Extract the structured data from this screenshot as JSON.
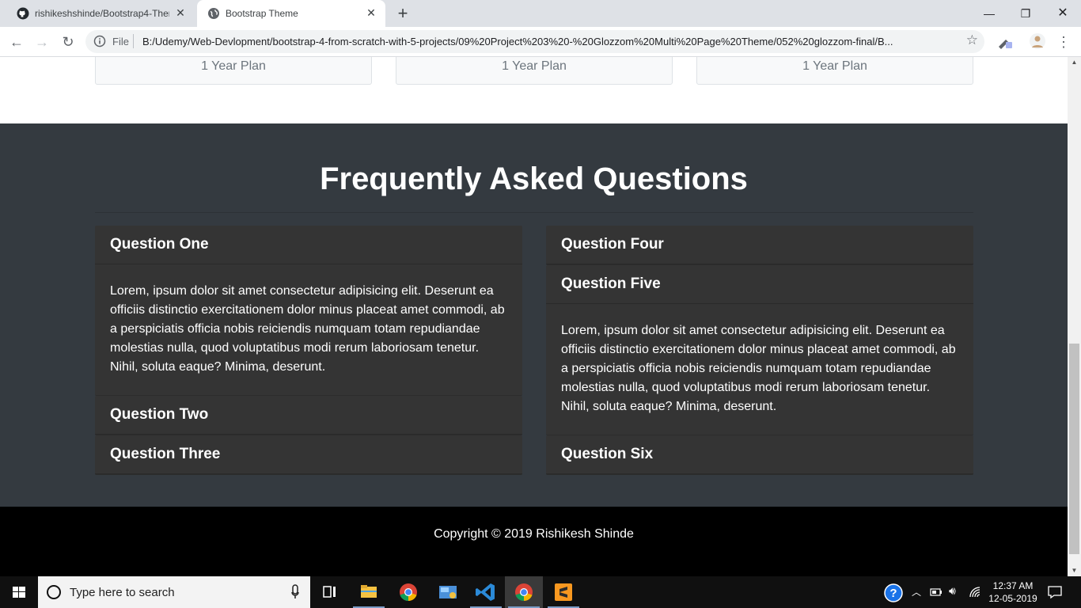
{
  "browser": {
    "tabs": [
      {
        "title": "rishikeshshinde/Bootstrap4-Theme",
        "active": false
      },
      {
        "title": "Bootstrap Theme",
        "active": true
      }
    ],
    "new_tab_label": "+",
    "address_scheme": "File",
    "address_url": "B:/Udemy/Web-Devlopment/bootstrap-4-from-scratch-with-5-projects/09%20Project%203%20-%20Glozzom%20Multi%20Page%20Theme/052%20glozzom-final/B..."
  },
  "page": {
    "plans": [
      {
        "label": "1 Year Plan"
      },
      {
        "label": "1 Year Plan"
      },
      {
        "label": "1 Year Plan"
      }
    ],
    "faq": {
      "title": "Frequently Asked Questions",
      "left": [
        {
          "question": "Question One",
          "answer": "Lorem, ipsum dolor sit amet consectetur adipisicing elit. Deserunt ea officiis distinctio exercitationem dolor minus placeat amet commodi, ab a perspiciatis officia nobis reiciendis numquam totam repudiandae molestias nulla, quod voluptatibus modi rerum laboriosam tenetur. Nihil, soluta eaque? Minima, deserunt.",
          "expanded": true
        },
        {
          "question": "Question Two",
          "answer": "",
          "expanded": false
        },
        {
          "question": "Question Three",
          "answer": "",
          "expanded": false
        }
      ],
      "right": [
        {
          "question": "Question Four",
          "answer": "",
          "expanded": false
        },
        {
          "question": "Question Five",
          "answer": "Lorem, ipsum dolor sit amet consectetur adipisicing elit. Deserunt ea officiis distinctio exercitationem dolor minus placeat amet commodi, ab a perspiciatis officia nobis reiciendis numquam totam repudiandae molestias nulla, quod voluptatibus modi rerum laboriosam tenetur. Nihil, soluta eaque? Minima, deserunt.",
          "expanded": true
        },
        {
          "question": "Question Six",
          "answer": "",
          "expanded": false
        }
      ]
    },
    "footer": {
      "copyright": "Copyright © 2019 Rishikesh Shinde"
    }
  },
  "taskbar": {
    "search_placeholder": "Type here to search",
    "time": "12:37 AM",
    "date": "12-05-2019"
  },
  "colors": {
    "faq_bg": "#343a40",
    "card_bg": "#343434",
    "footer_bg": "#000000",
    "tabstrip_bg": "#dee1e6"
  }
}
